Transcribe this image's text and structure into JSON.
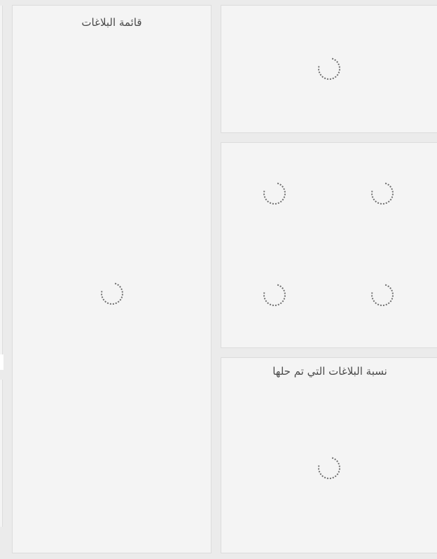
{
  "panels": {
    "reports_list": {
      "title": "قائمة البلاغات"
    },
    "top_right": {
      "title": ""
    },
    "stats_grid": {
      "title": ""
    },
    "resolved_ratio": {
      "title": "نسبة البلاغات التي تم حلها"
    }
  },
  "loading_state": {
    "icon": "loading-spinner-icon",
    "spinner_color": "#6f6f6f"
  },
  "colors": {
    "page_background": "#ebebeb",
    "panel_background": "#f4f4f4",
    "panel_border": "#dcdcdc",
    "title_text": "#4a4a4a"
  }
}
